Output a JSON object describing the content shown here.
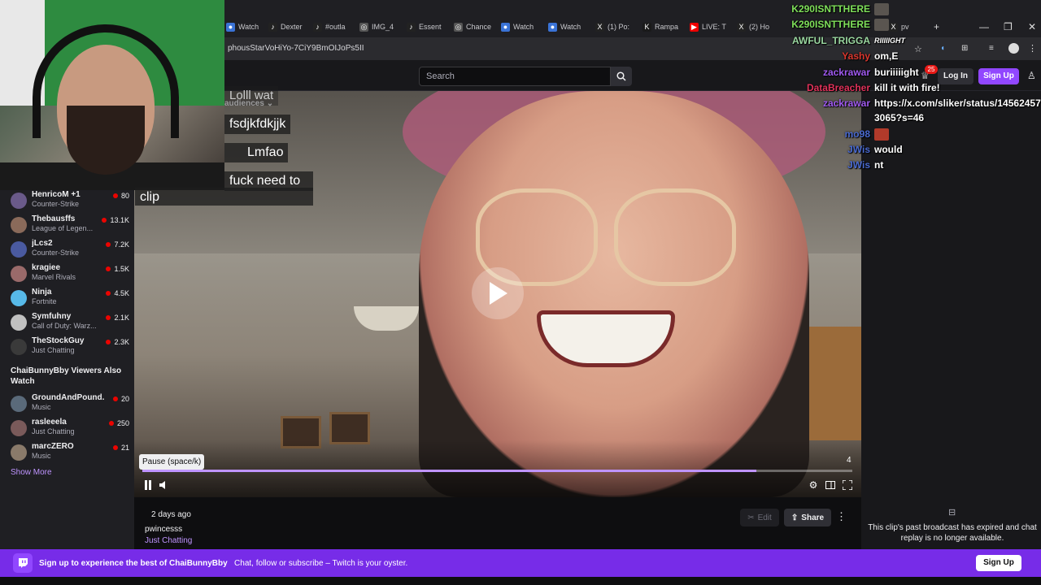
{
  "browser": {
    "tabs": [
      {
        "label": "Watch",
        "icon": "tab-icon"
      },
      {
        "label": "Dexter",
        "icon": "tiktok-icon"
      },
      {
        "label": "#outla",
        "icon": "tiktok-icon"
      },
      {
        "label": "IMG_4",
        "icon": "globe-icon"
      },
      {
        "label": "Essent",
        "icon": "tiktok-icon"
      },
      {
        "label": "Chance",
        "icon": "globe-icon"
      },
      {
        "label": "Watch",
        "icon": "tab-icon"
      },
      {
        "label": "Watch",
        "icon": "tab-icon"
      },
      {
        "label": "(1) Po:",
        "icon": "x-icon"
      },
      {
        "label": "Rampa",
        "icon": "kick-icon"
      },
      {
        "label": "LIVE: T",
        "icon": "youtube-icon"
      },
      {
        "label": "(2) Ho",
        "icon": "x-icon"
      },
      {
        "label": "pv",
        "icon": "x-icon"
      }
    ],
    "url": "phousStarVoHiYo-7CiY9BmOIJoPs5II",
    "new_tab": "+",
    "win_min": "—",
    "win_max": "❐",
    "win_close": "✕"
  },
  "nav": {
    "search_placeholder": "Search",
    "login": "Log In",
    "signup": "Sign Up",
    "notif_count": "25"
  },
  "sidebar": {
    "channels": [
      {
        "name": "HenricoM +1",
        "game": "Counter-Strike",
        "viewers": "80",
        "color": "#6a5a8a"
      },
      {
        "name": "Thebausffs",
        "game": "League of Legen...",
        "viewers": "13.1K",
        "color": "#8a6a5a"
      },
      {
        "name": "jLcs2",
        "game": "Counter-Strike",
        "viewers": "7.2K",
        "color": "#4a5aa0"
      },
      {
        "name": "kragiee",
        "game": "Marvel Rivals",
        "viewers": "1.5K",
        "color": "#9a6a6a"
      },
      {
        "name": "Ninja",
        "game": "Fortnite",
        "viewers": "4.5K",
        "color": "#57b9e8"
      },
      {
        "name": "Symfuhny",
        "game": "Call of Duty: Warz...",
        "viewers": "2.1K",
        "color": "#c0c0c0"
      },
      {
        "name": "TheStockGuy",
        "game": "Just Chatting",
        "viewers": "2.3K",
        "color": "#3a3a3a"
      }
    ],
    "also_watch_heading": "ChaiBunnyBby Viewers Also Watch",
    "also_watch": [
      {
        "name": "GroundAndPound...",
        "game": "Music",
        "viewers": "20",
        "color": "#5a6a7a"
      },
      {
        "name": "rasleeela",
        "game": "Just Chatting",
        "viewers": "250",
        "color": "#7a5a5a"
      },
      {
        "name": "marcZERO",
        "game": "Music",
        "viewers": "21",
        "color": "#8a7a6a"
      }
    ],
    "show_more": "Show More",
    "audiences_label": "audiences"
  },
  "video_chat": [
    {
      "text": "Lolll wat"
    },
    {
      "text": "fsdjkfdkjjk"
    },
    {
      "text": "Lmfao"
    },
    {
      "text": "fuck need to"
    },
    {
      "text": "clip"
    }
  ],
  "player": {
    "tooltip": "Pause (space/k)",
    "progress": 0.865,
    "counter": "4"
  },
  "clip": {
    "ago": "2 days ago",
    "title": "pwincesss",
    "category": "Just Chatting",
    "edit": "Edit",
    "share": "Share"
  },
  "chat_panel": {
    "expired": "This clip's past broadcast has expired and chat replay is no longer available."
  },
  "overlay_chat": [
    {
      "user": "K290ISNTTHERE",
      "msg": "",
      "color": "#7fe05a"
    },
    {
      "user": "K290ISNTTHERE",
      "msg": "",
      "color": "#7fe05a"
    },
    {
      "user": "AWFUL_TRIGGA",
      "msg": "RIIIIIGHT",
      "color": "#9ad7a0"
    },
    {
      "user": "Yashy",
      "msg": "om,E",
      "color": "#d9372e"
    },
    {
      "user": "zackrawar",
      "msg": "buriiiiight",
      "color": "#a05af0"
    },
    {
      "user": "DataBreacher",
      "msg": "kill it with fire!",
      "color": "#e0325a"
    },
    {
      "user": "zackrawar",
      "msg": "https://x.com/sliker/status/14562457",
      "color": "#a05af0"
    },
    {
      "user": "",
      "msg": "3065?s=46",
      "color": "#ffffff"
    },
    {
      "user": "mo98",
      "msg": "",
      "color": "#4a6ad0"
    },
    {
      "user": "JWis",
      "msg": "would",
      "color": "#4a6ad0"
    },
    {
      "user": "JWis",
      "msg": "nt",
      "color": "#4a6ad0"
    }
  ],
  "banner": {
    "bold": "Sign up to experience the best of ChaiBunnyBby",
    "rest": "Chat, follow or subscribe – Twitch is your oyster.",
    "signup": "Sign Up"
  },
  "colors": {
    "accent": "#9147ff",
    "banner": "#772ce8",
    "live": "#eb0400"
  }
}
